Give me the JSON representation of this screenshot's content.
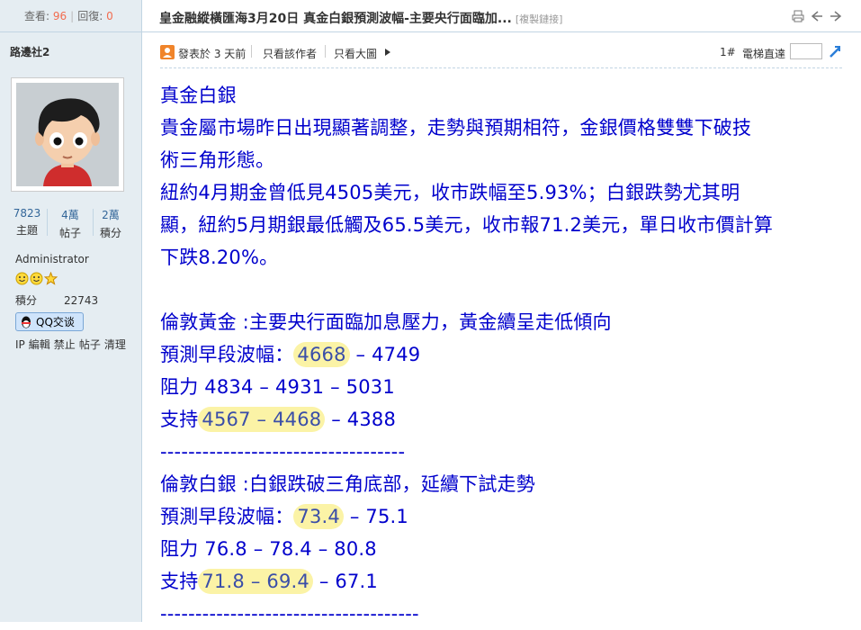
{
  "sidebar": {
    "view_label": "查看:",
    "view_count": "96",
    "reply_label": "回復:",
    "reply_count": "0",
    "author_name": "路邊社2",
    "stats": [
      {
        "value": "7823",
        "label": "主題"
      },
      {
        "value": "4萬",
        "label": "帖子"
      },
      {
        "value": "2萬",
        "label": "積分"
      }
    ],
    "role": "Administrator",
    "credit_label": "積分",
    "credit_value": "22743",
    "qq_label": "QQ交谈",
    "admin_links": [
      "IP",
      "編輯",
      "禁止",
      "帖子",
      "清理"
    ]
  },
  "header": {
    "title": "皇金融縱橫匯海3月20日 真金白銀預測波幅-主要央行面臨加...",
    "copy_link": "[複製鏈接]"
  },
  "meta": {
    "posted": "發表於 3 天前",
    "author_only": "只看該作者",
    "large_image": "只看大圖",
    "floor": "1#",
    "elevator": "電梯直達"
  },
  "post": {
    "heading": "真金白銀",
    "p1a": "貴金屬市場昨日出現顯著調整，走勢與預期相符，金銀價格雙雙下破技",
    "p1b": "術三角形態。",
    "p2a": "紐約4月期金曾低見4505美元，收市跌幅至5.93%；白銀跌勢尤其明",
    "p2b": "顯，紐約5月期銀最低觸及65.5美元，收市報71.2美元，單日收市價計算",
    "p2c": "下跌8.20%。",
    "gold_title": "倫敦黃金 :主要央行面臨加息壓力，黃金續呈走低傾向",
    "gold_range_label": "預測早段波幅：",
    "gold_range_hl": "4668",
    "gold_range_rest": " – 4749",
    "gold_resist": "阻力 4834 – 4931 – 5031",
    "gold_support_label": "支持",
    "gold_support_hl": "4567 – 4468",
    "gold_support_rest": " – 4388",
    "divider1": "-----------------------------------",
    "silver_title": "倫敦白銀 :白銀跌破三角底部，延續下試走勢",
    "silver_range_label": "預測早段波幅：",
    "silver_range_hl": "73.4",
    "silver_range_rest": " – 75.1",
    "silver_resist": "阻力 76.8 – 78.4 – 80.8",
    "silver_support_label": "支持",
    "silver_support_hl": "71.8 – 69.4",
    "silver_support_rest": " – 67.1",
    "divider2": "-------------------------------------"
  }
}
